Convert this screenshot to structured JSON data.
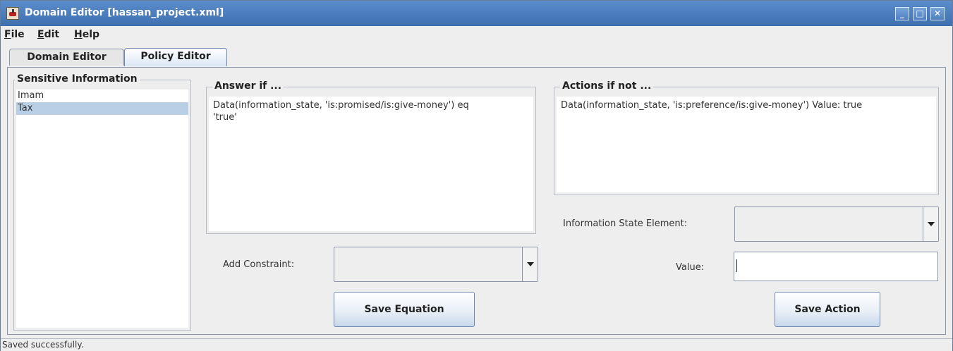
{
  "window": {
    "title": "Domain Editor [hassan_project.xml]",
    "controls": {
      "minimize": "_",
      "maximize": "□",
      "close": "✕"
    }
  },
  "menubar": {
    "items": [
      {
        "label": "File",
        "mnemonic": "F"
      },
      {
        "label": "Edit",
        "mnemonic": "E"
      },
      {
        "label": "Help",
        "mnemonic": "H"
      }
    ]
  },
  "tabs": [
    {
      "label": "Domain Editor",
      "selected": false
    },
    {
      "label": "Policy Editor",
      "selected": true
    }
  ],
  "sensitive": {
    "title": "Sensitive Information",
    "items": [
      {
        "label": "Imam",
        "selected": false
      },
      {
        "label": "Tax",
        "selected": true
      }
    ]
  },
  "answer": {
    "title": "Answer if ...",
    "text": "Data(information_state, 'is:promised/is:give-money') eq\n'true'"
  },
  "actions": {
    "title": "Actions if not ...",
    "text": "Data(information_state, 'is:preference/is:give-money') Value: true"
  },
  "constraint": {
    "label": "Add Constraint:",
    "selected": ""
  },
  "info_state": {
    "label": "Information State Element:",
    "selected": ""
  },
  "value_field": {
    "label": "Value:",
    "value": ""
  },
  "buttons": {
    "save_equation": "Save Equation",
    "save_action": "Save Action"
  },
  "status": {
    "text": "Saved successfully."
  }
}
